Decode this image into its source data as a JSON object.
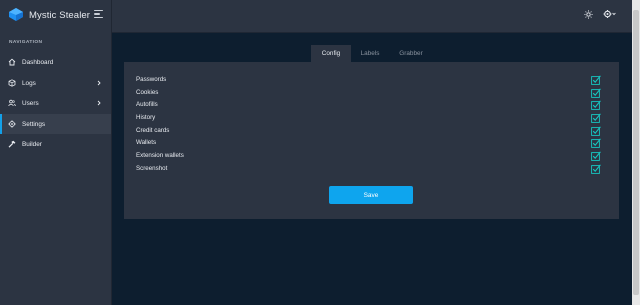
{
  "app": {
    "name": "Mystic Stealer"
  },
  "navigation": {
    "heading": "NAVIGATION",
    "items": [
      {
        "label": "Dashboard",
        "icon": "home-icon",
        "has_submenu": false,
        "active": false
      },
      {
        "label": "Logs",
        "icon": "box-icon",
        "has_submenu": true,
        "active": false
      },
      {
        "label": "Users",
        "icon": "users-icon",
        "has_submenu": true,
        "active": false
      },
      {
        "label": "Settings",
        "icon": "gear-icon",
        "has_submenu": false,
        "active": true
      },
      {
        "label": "Builder",
        "icon": "hammer-icon",
        "has_submenu": false,
        "active": false
      }
    ]
  },
  "topbar": {
    "theme_icon": "sun-icon",
    "settings_icon": "gear-dropdown-icon"
  },
  "tabs": [
    {
      "label": "Config",
      "active": true
    },
    {
      "label": "Labels",
      "active": false
    },
    {
      "label": "Grabber",
      "active": false
    }
  ],
  "config": {
    "options": [
      {
        "label": "Passwords",
        "checked": true
      },
      {
        "label": "Cookies",
        "checked": true
      },
      {
        "label": "Autofills",
        "checked": true
      },
      {
        "label": "History",
        "checked": true
      },
      {
        "label": "Credit cards",
        "checked": true
      },
      {
        "label": "Wallets",
        "checked": true
      },
      {
        "label": "Extension wallets",
        "checked": true
      },
      {
        "label": "Screenshot",
        "checked": true
      }
    ],
    "save_label": "Save"
  },
  "colors": {
    "accent": "#0ea5ee",
    "check": "#16c7c2",
    "sidebar_bg": "#2c3442",
    "content_bg": "#0d1e2f",
    "panel_bg": "#2c3442"
  }
}
